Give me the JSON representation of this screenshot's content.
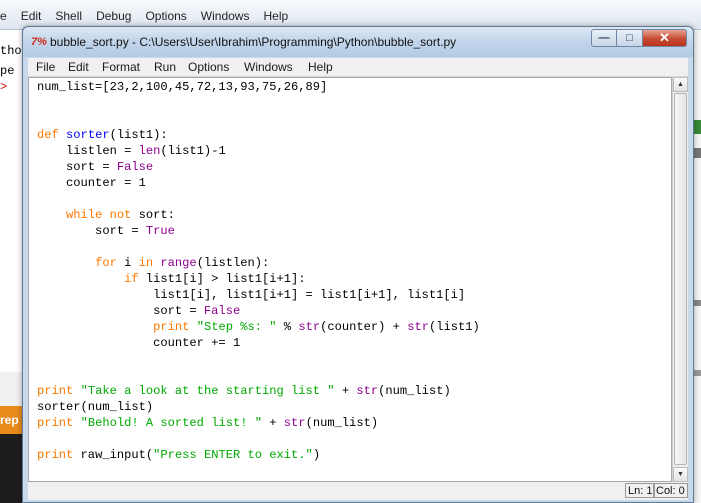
{
  "background": {
    "menu": [
      "e",
      "Edit",
      "Shell",
      "Debug",
      "Options",
      "Windows",
      "Help"
    ],
    "left_fragment_1": "tho",
    "left_fragment_2": "pe",
    "left_fragment_3": ">",
    "left_tab_fragment": "rep"
  },
  "window": {
    "title": "bubble_sort.py - C:\\Users\\User\\Ibrahim\\Programming\\Python\\bubble_sort.py",
    "app_icon": "7%",
    "buttons": {
      "minimize": "—",
      "maximize": "□",
      "close": "✕"
    }
  },
  "menu": [
    "File",
    "Edit",
    "Format",
    "Run",
    "Options",
    "Windows",
    "Help"
  ],
  "code": [
    [
      {
        "t": "num_list=[23,2,100,45,72,13,93,75,26,89]",
        "c": ""
      }
    ],
    [
      {
        "t": "",
        "c": ""
      }
    ],
    [
      {
        "t": "",
        "c": ""
      }
    ],
    [
      {
        "t": "def",
        "c": "kw"
      },
      {
        "t": " ",
        "c": ""
      },
      {
        "t": "sorter",
        "c": "df"
      },
      {
        "t": "(list1):",
        "c": ""
      }
    ],
    [
      {
        "t": "    listlen = ",
        "c": ""
      },
      {
        "t": "len",
        "c": "bi"
      },
      {
        "t": "(list1)-1",
        "c": ""
      }
    ],
    [
      {
        "t": "    sort = ",
        "c": ""
      },
      {
        "t": "False",
        "c": "bi"
      }
    ],
    [
      {
        "t": "    counter = 1",
        "c": ""
      }
    ],
    [
      {
        "t": "",
        "c": ""
      }
    ],
    [
      {
        "t": "    ",
        "c": ""
      },
      {
        "t": "while",
        "c": "kw"
      },
      {
        "t": " ",
        "c": ""
      },
      {
        "t": "not",
        "c": "kw"
      },
      {
        "t": " sort:",
        "c": ""
      }
    ],
    [
      {
        "t": "        sort = ",
        "c": ""
      },
      {
        "t": "True",
        "c": "bi"
      }
    ],
    [
      {
        "t": "",
        "c": ""
      }
    ],
    [
      {
        "t": "        ",
        "c": ""
      },
      {
        "t": "for",
        "c": "kw"
      },
      {
        "t": " i ",
        "c": ""
      },
      {
        "t": "in",
        "c": "kw"
      },
      {
        "t": " ",
        "c": ""
      },
      {
        "t": "range",
        "c": "bi"
      },
      {
        "t": "(listlen):",
        "c": ""
      }
    ],
    [
      {
        "t": "            ",
        "c": ""
      },
      {
        "t": "if",
        "c": "kw"
      },
      {
        "t": " list1[i] > list1[i+1]:",
        "c": ""
      }
    ],
    [
      {
        "t": "                list1[i], list1[i+1] = list1[i+1], list1[i]",
        "c": ""
      }
    ],
    [
      {
        "t": "                sort = ",
        "c": ""
      },
      {
        "t": "False",
        "c": "bi"
      }
    ],
    [
      {
        "t": "                ",
        "c": ""
      },
      {
        "t": "print",
        "c": "kw"
      },
      {
        "t": " ",
        "c": ""
      },
      {
        "t": "\"Step %s: \"",
        "c": "st"
      },
      {
        "t": " % ",
        "c": ""
      },
      {
        "t": "str",
        "c": "bi"
      },
      {
        "t": "(counter) + ",
        "c": ""
      },
      {
        "t": "str",
        "c": "bi"
      },
      {
        "t": "(list1)",
        "c": ""
      }
    ],
    [
      {
        "t": "                counter += 1",
        "c": ""
      }
    ],
    [
      {
        "t": "",
        "c": ""
      }
    ],
    [
      {
        "t": "",
        "c": ""
      }
    ],
    [
      {
        "t": "print",
        "c": "kw"
      },
      {
        "t": " ",
        "c": ""
      },
      {
        "t": "\"Take a look at the starting list \"",
        "c": "st"
      },
      {
        "t": " + ",
        "c": ""
      },
      {
        "t": "str",
        "c": "bi"
      },
      {
        "t": "(num_list)",
        "c": ""
      }
    ],
    [
      {
        "t": "sorter(num_list)",
        "c": ""
      }
    ],
    [
      {
        "t": "print",
        "c": "kw"
      },
      {
        "t": " ",
        "c": ""
      },
      {
        "t": "\"Behold! A sorted list! \"",
        "c": "st"
      },
      {
        "t": " + ",
        "c": ""
      },
      {
        "t": "str",
        "c": "bi"
      },
      {
        "t": "(num_list)",
        "c": ""
      }
    ],
    [
      {
        "t": "",
        "c": ""
      }
    ],
    [
      {
        "t": "print",
        "c": "kw"
      },
      {
        "t": " raw_input(",
        "c": ""
      },
      {
        "t": "\"Press ENTER to exit.\"",
        "c": "st"
      },
      {
        "t": ")",
        "c": ""
      }
    ]
  ],
  "syntax_colors": {
    "keyword": "#ff7700",
    "builtin": "#900090",
    "string": "#00aa00",
    "definition": "#0000ff"
  },
  "status": {
    "line": "Ln: 1",
    "col": "Col: 0"
  }
}
